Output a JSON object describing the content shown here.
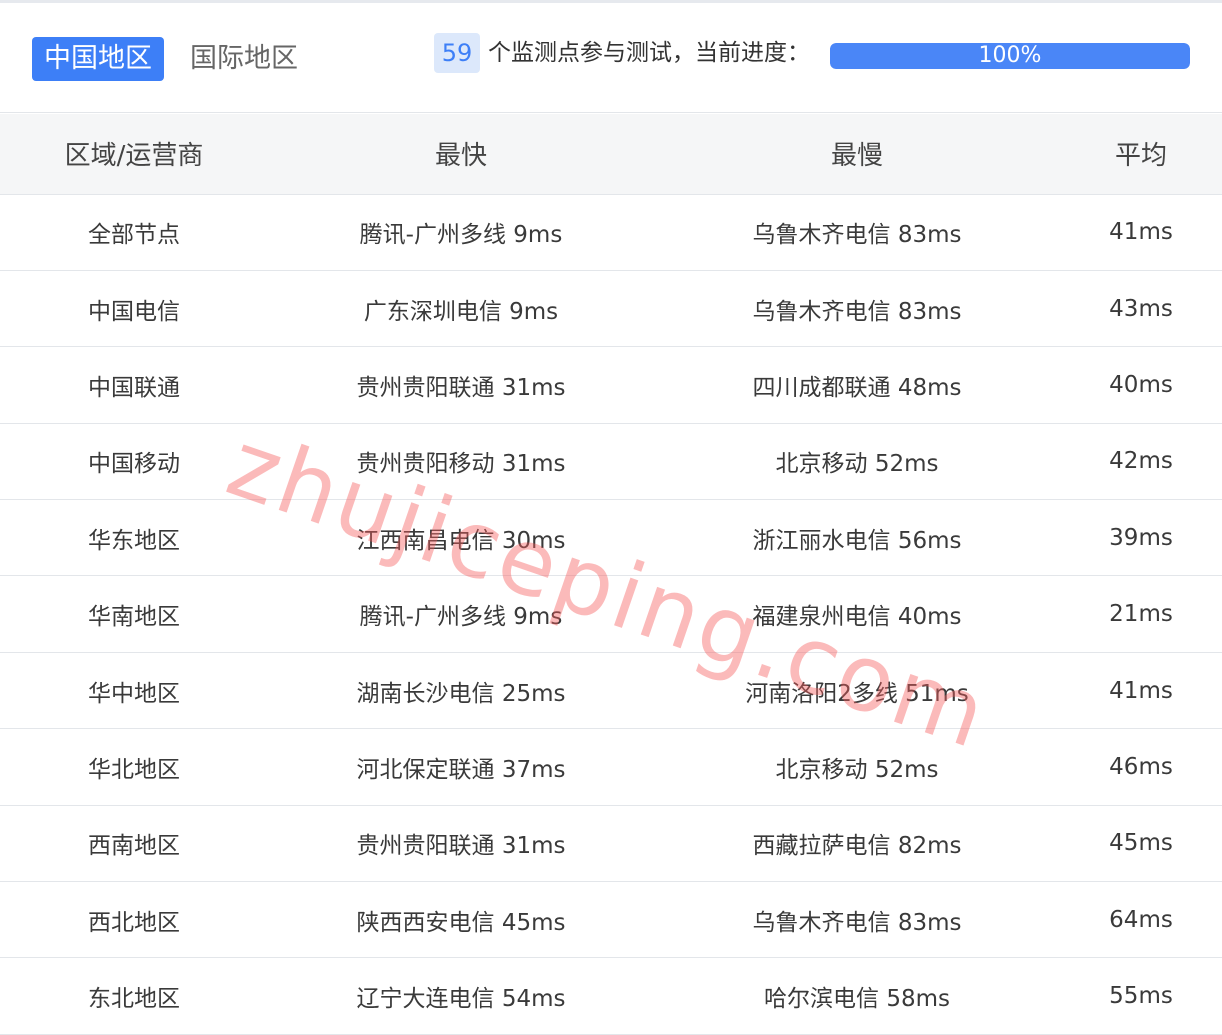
{
  "tabs": {
    "active": "中国地区",
    "inactive": "国际地区"
  },
  "progress": {
    "monitor_count": "59",
    "label": "个监测点参与测试，当前进度：",
    "percent_value": 100,
    "percent_text": "100%"
  },
  "table": {
    "headers": [
      "区域/运营商",
      "最快",
      "最慢",
      "平均"
    ],
    "rows": [
      [
        "全部节点",
        "腾讯-广州多线 9ms",
        "乌鲁木齐电信 83ms",
        "41ms"
      ],
      [
        "中国电信",
        "广东深圳电信 9ms",
        "乌鲁木齐电信 83ms",
        "43ms"
      ],
      [
        "中国联通",
        "贵州贵阳联通 31ms",
        "四川成都联通 48ms",
        "40ms"
      ],
      [
        "中国移动",
        "贵州贵阳移动 31ms",
        "北京移动 52ms",
        "42ms"
      ],
      [
        "华东地区",
        "江西南昌电信 30ms",
        "浙江丽水电信 56ms",
        "39ms"
      ],
      [
        "华南地区",
        "腾讯-广州多线 9ms",
        "福建泉州电信 40ms",
        "21ms"
      ],
      [
        "华中地区",
        "湖南长沙电信 25ms",
        "河南洛阳2多线 51ms",
        "41ms"
      ],
      [
        "华北地区",
        "河北保定联通 37ms",
        "北京移动 52ms",
        "46ms"
      ],
      [
        "西南地区",
        "贵州贵阳联通 31ms",
        "西藏拉萨电信 82ms",
        "45ms"
      ],
      [
        "西北地区",
        "陕西西安电信 45ms",
        "乌鲁木齐电信 83ms",
        "64ms"
      ],
      [
        "东北地区",
        "辽宁大连电信 54ms",
        "哈尔滨电信 58ms",
        "55ms"
      ]
    ]
  },
  "watermark": "zhujiceping.com",
  "colors": {
    "accent": "#3d7ff7",
    "badge_bg": "#dce8fb",
    "header_bg": "#f5f6f7",
    "watermark": "#f55a5a"
  }
}
